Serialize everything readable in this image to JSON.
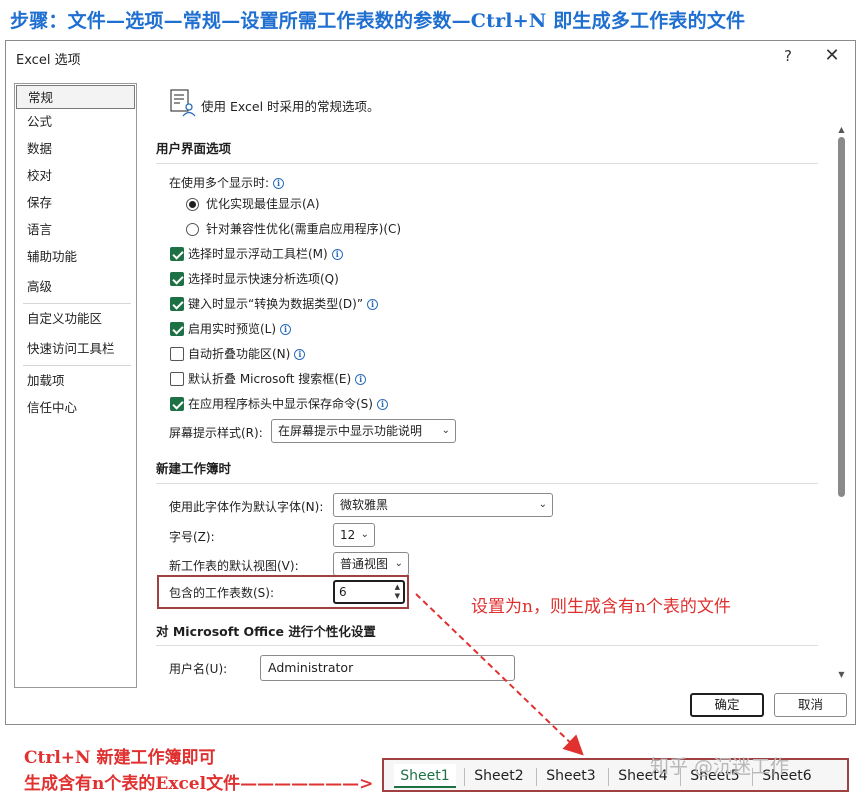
{
  "headline": "步骤：文件—选项—常规—设置所需工作表数的参数—Ctrl+N 即生成多工作表的文件",
  "dialog": {
    "title": "Excel 选项",
    "help": "?",
    "close": "✕",
    "nav_items": [
      "常规",
      "公式",
      "数据",
      "校对",
      "保存",
      "语言",
      "辅助功能",
      "高级",
      "自定义功能区",
      "快速访问工具栏",
      "加载项",
      "信任中心"
    ],
    "intro": "使用 Excel 时采用的常规选项。",
    "ui_section": {
      "title": "用户界面选项",
      "multi_display_label": "在使用多个显示时:",
      "radio_optimize": "优化实现最佳显示(A)",
      "radio_compat": "针对兼容性优化(需重启应用程序)(C)",
      "checkboxes": [
        {
          "label": "选择时显示浮动工具栏(M)",
          "checked": true,
          "info": true
        },
        {
          "label": "选择时显示快速分析选项(Q)",
          "checked": true,
          "info": false
        },
        {
          "label": "键入时显示“转换为数据类型(D)”",
          "checked": true,
          "info": true
        },
        {
          "label": "启用实时预览(L)",
          "checked": true,
          "info": true
        },
        {
          "label": "自动折叠功能区(N)",
          "checked": false,
          "info": true
        },
        {
          "label": "默认折叠 Microsoft 搜索框(E)",
          "checked": false,
          "info": true
        },
        {
          "label": "在应用程序标头中显示保存命令(S)",
          "checked": true,
          "info": true
        }
      ],
      "tooltip_style_label": "屏幕提示样式(R):",
      "tooltip_style_value": "在屏幕提示中显示功能说明"
    },
    "new_workbook": {
      "title": "新建工作簿时",
      "font_label": "使用此字体作为默认字体(N):",
      "font_value": "微软雅黑",
      "size_label": "字号(Z):",
      "size_value": "12",
      "view_label": "新工作表的默认视图(V):",
      "view_value": "普通视图",
      "sheets_label": "包含的工作表数(S):",
      "sheets_value": "6"
    },
    "personalize": {
      "title": "对 Microsoft Office 进行个性化设置",
      "username_label": "用户名(U):",
      "username_value": "Administrator"
    },
    "ok": "确定",
    "cancel": "取消"
  },
  "annotation_right": "设置为n，则生成含有n个表的文件",
  "annotation_bottom_1": "Ctrl+N 新建工作簿即可",
  "annotation_bottom_2": "生成含有n个表的Excel文件———————>",
  "sheet_tabs": [
    "Sheet1",
    "Sheet2",
    "Sheet3",
    "Sheet4",
    "Sheet5",
    "Sheet6"
  ],
  "watermark": "知乎 @沉迷工作",
  "colors": {
    "headline": "#1f6fd1",
    "annotation": "#e03030",
    "highlight_box": "#a04040",
    "checkbox": "#1e7145",
    "info": "#2b6cb8"
  }
}
